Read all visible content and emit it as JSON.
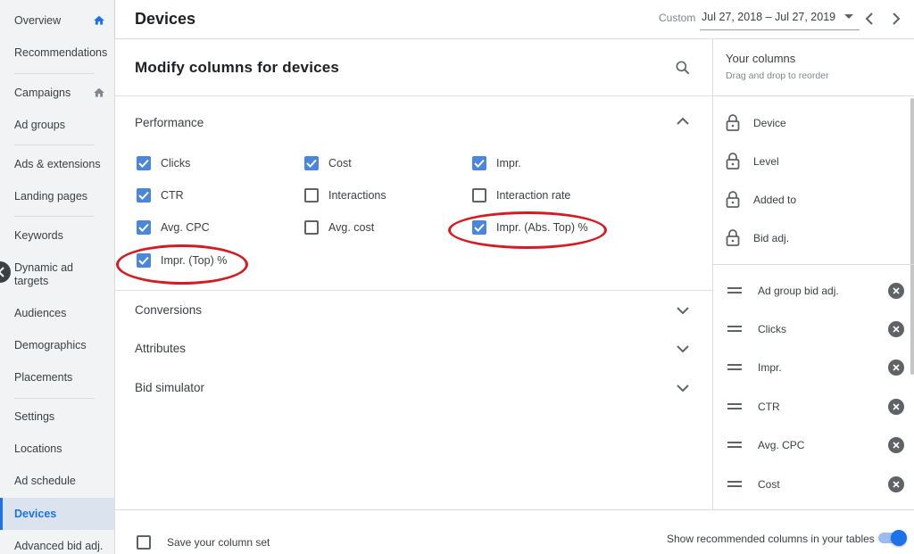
{
  "sidebar": {
    "items": [
      {
        "label": "Overview",
        "icon": "home-icon"
      },
      {
        "label": "Recommendations"
      },
      {
        "label": "Campaigns",
        "icon": "home-icon"
      },
      {
        "label": "Ad groups"
      },
      {
        "label": "Ads & extensions"
      },
      {
        "label": "Landing pages"
      },
      {
        "label": "Keywords"
      },
      {
        "label": "Dynamic ad targets"
      },
      {
        "label": "Audiences"
      },
      {
        "label": "Demographics"
      },
      {
        "label": "Placements"
      },
      {
        "label": "Settings"
      },
      {
        "label": "Locations"
      },
      {
        "label": "Ad schedule"
      },
      {
        "label": "Devices",
        "active": true
      },
      {
        "label": "Advanced bid adj."
      }
    ]
  },
  "header": {
    "title": "Devices",
    "date_label": "Custom",
    "date_range": "Jul 27, 2018 – Jul 27, 2019"
  },
  "panel": {
    "title": "Modify columns for devices",
    "sections": [
      {
        "title": "Performance",
        "expanded": true
      },
      {
        "title": "Conversions",
        "expanded": false
      },
      {
        "title": "Attributes",
        "expanded": false
      },
      {
        "title": "Bid simulator",
        "expanded": false
      }
    ],
    "performance_options": [
      {
        "label": "Clicks",
        "checked": true
      },
      {
        "label": "Cost",
        "checked": true
      },
      {
        "label": "Impr.",
        "checked": true
      },
      {
        "label": "CTR",
        "checked": true
      },
      {
        "label": "Interactions",
        "checked": false
      },
      {
        "label": "Interaction rate",
        "checked": false
      },
      {
        "label": "Avg. CPC",
        "checked": true
      },
      {
        "label": "Avg. cost",
        "checked": false
      },
      {
        "label": "Impr. (Abs. Top) %",
        "checked": true,
        "highlighted": true
      },
      {
        "label": "Impr. (Top) %",
        "checked": true,
        "highlighted": true
      }
    ]
  },
  "your_columns": {
    "title": "Your columns",
    "subtitle": "Drag and drop to reorder",
    "locked": [
      "Device",
      "Level",
      "Added to",
      "Bid adj."
    ],
    "columns": [
      "Ad group bid adj.",
      "Clicks",
      "Impr.",
      "CTR",
      "Avg. CPC",
      "Cost"
    ]
  },
  "footer": {
    "save_label": "Save your column set",
    "save_checked": false,
    "show_recommended_label": "Show recommended columns in your tables",
    "show_recommended_on": true
  },
  "colors": {
    "accent": "#1a73e8",
    "checkbox": "#4a87dc",
    "highlight": "#d41c23"
  }
}
